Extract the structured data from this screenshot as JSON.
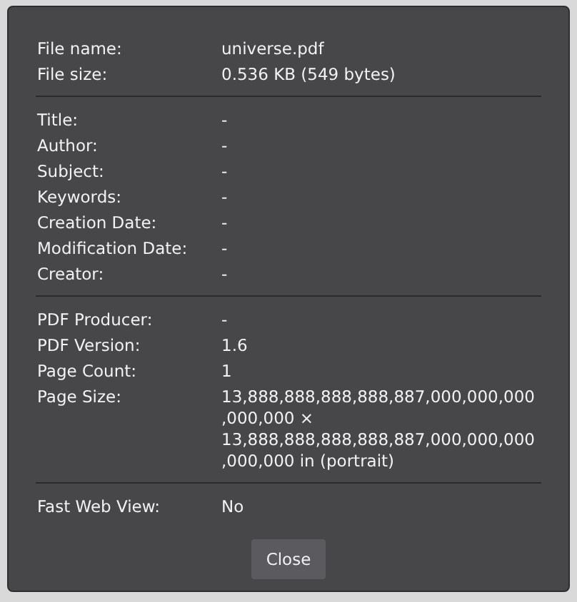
{
  "sections": [
    {
      "rows": [
        {
          "label": "File name:",
          "value": "universe.pdf"
        },
        {
          "label": "File size:",
          "value": "0.536 KB (549 bytes)"
        }
      ]
    },
    {
      "rows": [
        {
          "label": "Title:",
          "value": "-"
        },
        {
          "label": "Author:",
          "value": "-"
        },
        {
          "label": "Subject:",
          "value": "-"
        },
        {
          "label": "Keywords:",
          "value": "-"
        },
        {
          "label": "Creation Date:",
          "value": "-"
        },
        {
          "label": "Modification Date:",
          "value": "-"
        },
        {
          "label": "Creator:",
          "value": "-"
        }
      ]
    },
    {
      "rows": [
        {
          "label": "PDF Producer:",
          "value": "-"
        },
        {
          "label": "PDF Version:",
          "value": "1.6"
        },
        {
          "label": "Page Count:",
          "value": "1"
        },
        {
          "label": "Page Size:",
          "value": "13,888,888,888,888,887,000,000,000,000,000 × 13,888,888,888,888,887,000,000,000,000,000 in (portrait)"
        }
      ]
    },
    {
      "rows": [
        {
          "label": "Fast Web View:",
          "value": "No"
        }
      ]
    }
  ],
  "buttons": [
    {
      "label": "Close"
    }
  ]
}
